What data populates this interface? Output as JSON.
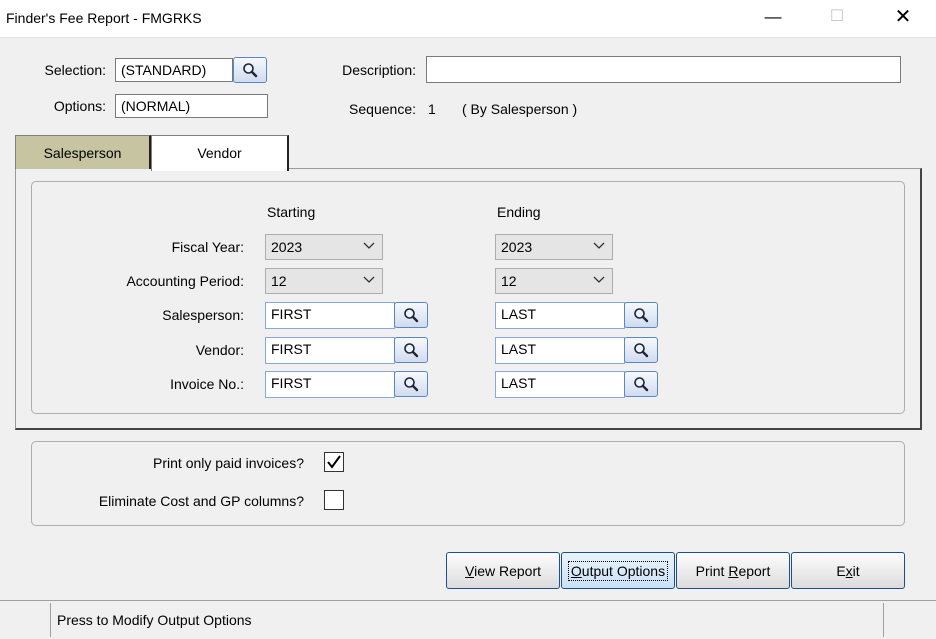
{
  "window": {
    "title": "Finder's Fee Report - FMGRKS",
    "minimize_glyph": "—",
    "maximize_glyph": "☐",
    "close_glyph": "✕"
  },
  "header": {
    "selection_label": "Selection:",
    "selection_value": "(STANDARD)",
    "options_label": "Options:",
    "options_value": "(NORMAL)",
    "description_label": "Description:",
    "description_value": "",
    "sequence_label": "Sequence:",
    "sequence_value": "1",
    "sequence_desc": "( By Salesperson )"
  },
  "tabs": [
    {
      "label": "Salesperson",
      "active": true
    },
    {
      "label": "Vendor",
      "active": false
    }
  ],
  "ranges": {
    "starting_header": "Starting",
    "ending_header": "Ending",
    "rows": [
      {
        "label": "Fiscal Year:",
        "start": "2023",
        "end": "2023"
      },
      {
        "label": "Accounting Period:",
        "start": "12",
        "end": "12"
      },
      {
        "label": "Salesperson:",
        "start": "FIRST",
        "end": "LAST"
      },
      {
        "label": "Vendor:",
        "start": "FIRST",
        "end": "LAST"
      },
      {
        "label": "Invoice No.:",
        "start": "FIRST",
        "end": "LAST"
      }
    ]
  },
  "options": {
    "paid_only_label": "Print only paid invoices?",
    "paid_only_checked": true,
    "eliminate_label": "Eliminate Cost and GP columns?",
    "eliminate_checked": false
  },
  "buttons": {
    "view_report": {
      "pre": "",
      "key": "V",
      "post": "iew Report"
    },
    "output_options": {
      "pre": "",
      "key": "O",
      "post": "utput Options"
    },
    "print_report": {
      "pre": "Print ",
      "key": "R",
      "post": "eport"
    },
    "exit": {
      "pre": "E",
      "key": "x",
      "post": "it"
    }
  },
  "status": {
    "text": "Press to Modify Output Options"
  },
  "colors": {
    "active_tab": "#c6c4a1",
    "lookup_border": "#5b86c4",
    "button_border": "#1e4e8c"
  }
}
